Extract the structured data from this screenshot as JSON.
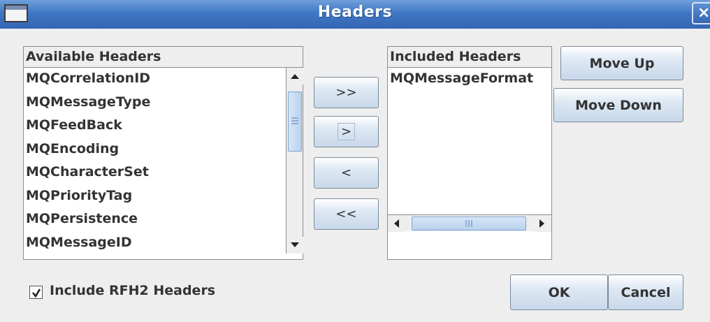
{
  "window": {
    "title": "Headers",
    "window_icon": "window-icon",
    "close_label": "×"
  },
  "available": {
    "header": "Available Headers",
    "items": [
      "MQCorrelationID",
      "MQMessageType",
      "MQFeedBack",
      "MQEncoding",
      "MQCharacterSet",
      "MQPriorityTag",
      "MQPersistence",
      "MQMessageID"
    ]
  },
  "included": {
    "header": "Included Headers",
    "items": [
      "MQMessageFormat"
    ]
  },
  "transfer_buttons": {
    "add_all": ">>",
    "add": ">",
    "remove": "<",
    "remove_all": "<<"
  },
  "order_buttons": {
    "move_up": "Move Up",
    "move_down": "Move Down"
  },
  "options": {
    "include_rfh2_label": "Include RFH2 Headers",
    "include_rfh2_checked": true
  },
  "dialog_buttons": {
    "ok": "OK",
    "cancel": "Cancel"
  },
  "icons": {
    "scroll_up": "arrow-up-icon",
    "scroll_down": "arrow-down-icon",
    "scroll_left": "arrow-left-icon",
    "scroll_right": "arrow-right-icon",
    "check": "check-icon"
  },
  "colors": {
    "titlebar": "#3f77c4",
    "dialog_bg": "#eeeeee",
    "button_gradient_end": "#c8d8ea"
  }
}
